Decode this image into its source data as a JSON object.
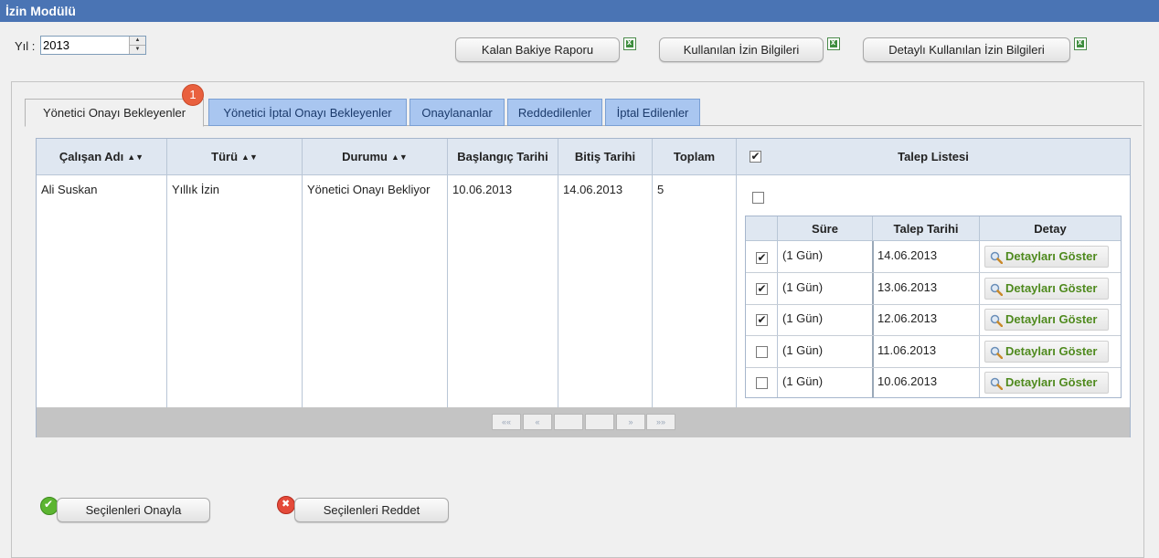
{
  "title": "İzin Modülü",
  "year": {
    "label": "Yıl :",
    "value": "2013"
  },
  "reports": [
    {
      "label": "Kalan Bakiye Raporu",
      "icon": "excel-icon"
    },
    {
      "label": "Kullanılan İzin Bilgileri",
      "icon": "excel-icon"
    },
    {
      "label": "Detaylı Kullanılan İzin Bilgileri",
      "icon": "excel-icon"
    }
  ],
  "tabs": [
    {
      "label": "Yönetici Onayı Bekleyenler",
      "active": true,
      "badge": "1"
    },
    {
      "label": "Yönetici İptal Onayı Bekleyenler"
    },
    {
      "label": "Onaylananlar"
    },
    {
      "label": "Reddedilenler"
    },
    {
      "label": "İptal Edilenler"
    }
  ],
  "grid": {
    "headers": {
      "employee": "Çalışan Adı",
      "type": "Türü",
      "status": "Durumu",
      "start": "Başlangıç Tarihi",
      "end": "Bitiş Tarihi",
      "total": "Toplam",
      "requests": "Talep Listesi"
    },
    "row": {
      "employee": "Ali Suskan",
      "type": "Yıllık İzin",
      "status": "Yönetici Onayı Bekliyor",
      "start": "10.06.2013",
      "end": "14.06.2013",
      "total": "5"
    },
    "pager": [
      "««",
      "«",
      "",
      "",
      "»",
      "»»"
    ]
  },
  "requests": {
    "headers": {
      "duration": "Süre",
      "date": "Talep Tarihi",
      "detail": "Detay"
    },
    "detail_label": "Detayları Göster",
    "items": [
      {
        "checked": true,
        "duration": "(1 Gün)",
        "date": "14.06.2013"
      },
      {
        "checked": true,
        "duration": "(1 Gün)",
        "date": "13.06.2013"
      },
      {
        "checked": true,
        "duration": "(1 Gün)",
        "date": "12.06.2013"
      },
      {
        "checked": false,
        "duration": "(1 Gün)",
        "date": "11.06.2013"
      },
      {
        "checked": false,
        "duration": "(1 Gün)",
        "date": "10.06.2013"
      }
    ]
  },
  "actions": {
    "approve": "Seçilenleri Onayla",
    "reject": "Seçilenleri Reddet"
  },
  "colors": {
    "titlebar": "#4a74b4",
    "tab": "#a9c6f0",
    "header": "#dfe7f1",
    "detail_text": "#4f8a1e",
    "badge": "#e9603e"
  }
}
